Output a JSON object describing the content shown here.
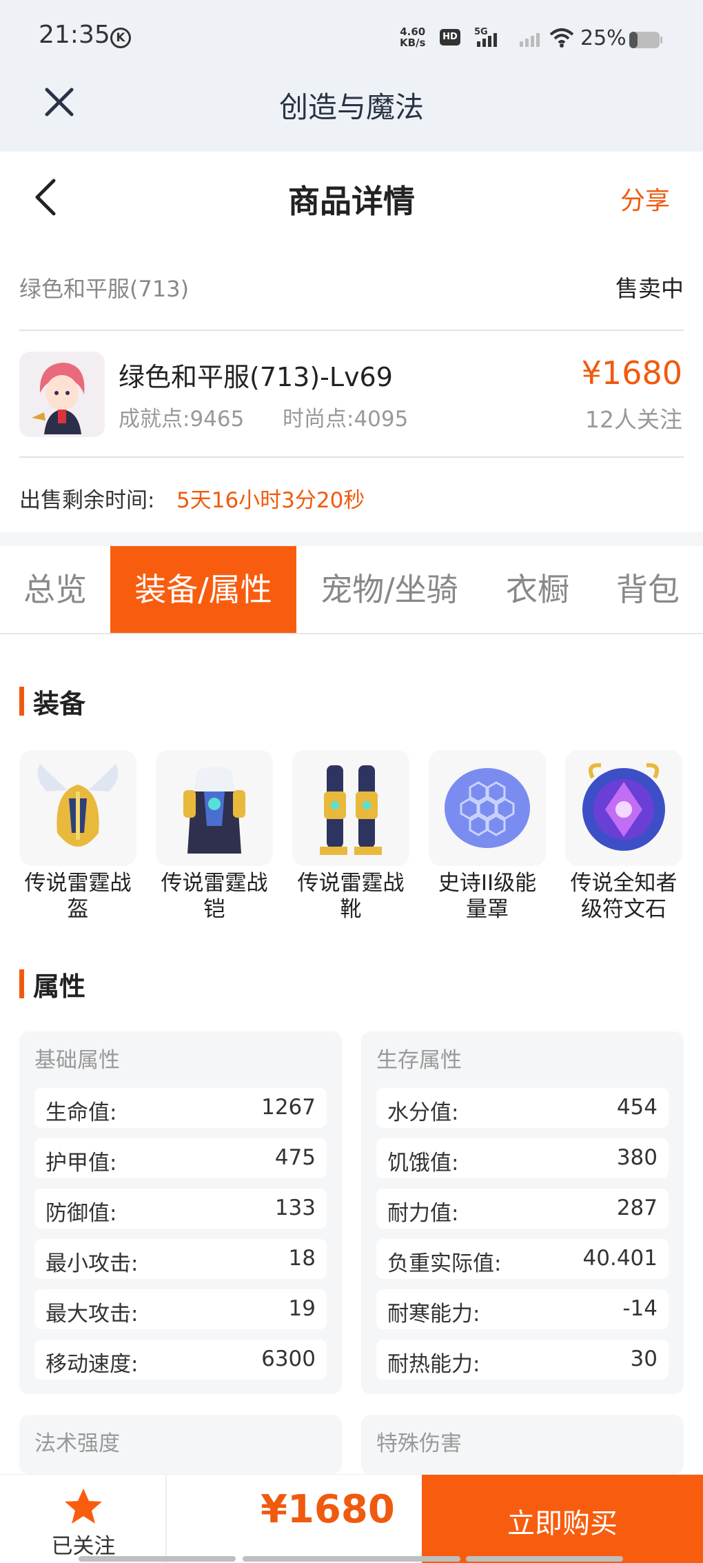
{
  "status": {
    "time": "21:35",
    "k_badge": "K",
    "net_speed_top": "4.60",
    "net_speed_unit": "KB/s",
    "hd": "HD",
    "network": "5G",
    "battery": "25%"
  },
  "app": {
    "title": "创造与魔法"
  },
  "header": {
    "title": "商品详情",
    "share": "分享"
  },
  "listing": {
    "role_name": "绿色和平服(713)",
    "sale_status": "售卖中",
    "item_name": "绿色和平服(713)-Lv69",
    "achievement": "成就点:9465",
    "fashion": "时尚点:4095",
    "price": "¥1680",
    "followers": "12人关注",
    "remain_label": "出售剩余时间:",
    "remain_value": "5天16小时3分20秒"
  },
  "tabs": [
    "总览",
    "装备/属性",
    "宠物/坐骑",
    "衣橱",
    "背包"
  ],
  "equipment": {
    "title": "装备",
    "items": [
      {
        "name": "传说雷霆战盔",
        "icon": "helmet-icon"
      },
      {
        "name": "传说雷霆战铠",
        "icon": "armor-icon"
      },
      {
        "name": "传说雷霆战靴",
        "icon": "boots-icon"
      },
      {
        "name": "史诗II级能量罩",
        "icon": "shield-icon"
      },
      {
        "name": "传说全知者级符文石",
        "icon": "rune-icon"
      }
    ]
  },
  "attributes": {
    "title": "属性",
    "basic": {
      "title": "基础属性",
      "rows": [
        {
          "k": "生命值:",
          "v": "1267"
        },
        {
          "k": "护甲值:",
          "v": "475"
        },
        {
          "k": "防御值:",
          "v": "133"
        },
        {
          "k": "最小攻击:",
          "v": "18"
        },
        {
          "k": "最大攻击:",
          "v": "19"
        },
        {
          "k": "移动速度:",
          "v": "6300"
        }
      ]
    },
    "survival": {
      "title": "生存属性",
      "rows": [
        {
          "k": "水分值:",
          "v": "454"
        },
        {
          "k": "饥饿值:",
          "v": "380"
        },
        {
          "k": "耐力值:",
          "v": "287"
        },
        {
          "k": "负重实际值:",
          "v": "40.401"
        },
        {
          "k": "耐寒能力:",
          "v": "-14"
        },
        {
          "k": "耐热能力:",
          "v": "30"
        }
      ]
    },
    "magic": {
      "title": "法术强度"
    },
    "special": {
      "title": "特殊伤害"
    }
  },
  "bottom": {
    "follow": "已关注",
    "price": "¥1680",
    "buy": "立即购买"
  },
  "colors": {
    "accent": "#f85d0f",
    "price": "#f05a0e"
  }
}
